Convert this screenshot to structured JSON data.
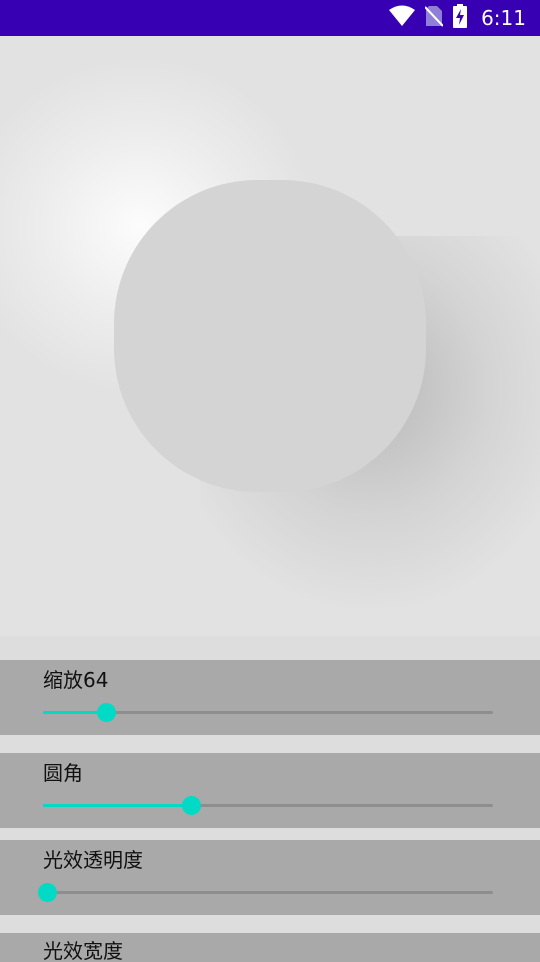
{
  "status_bar": {
    "time": "6:11",
    "color": "#3700b3",
    "icons": [
      "wifi-icon",
      "no-sim-icon",
      "battery-charging-icon"
    ]
  },
  "preview": {
    "background": "#e2e2e2",
    "shape_color": "#d4d4d4"
  },
  "controls": {
    "accent_color": "#03dac5",
    "panel_color": "#a9a9a9",
    "sliders": [
      {
        "label": "缩放64",
        "value_fraction": 0.14
      },
      {
        "label": "圆角",
        "value_fraction": 0.33
      },
      {
        "label": "光效透明度",
        "value_fraction": 0.0
      }
    ],
    "partial_panel_label": "光效宽度"
  }
}
